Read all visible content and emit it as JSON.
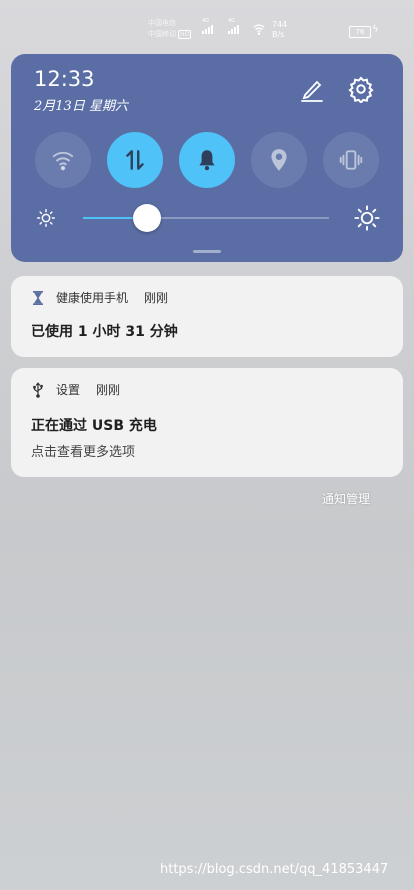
{
  "status_bar": {
    "carrier_1": "中国电信",
    "carrier_2": "中国移动",
    "hd_badge": "HD",
    "net_1": "4G",
    "net_2": "4G",
    "speed_value": "744",
    "speed_unit": "B/s",
    "battery": "76"
  },
  "quick_settings": {
    "time": "12:33",
    "date": "2月13日 星期六",
    "brightness_level": 0.26,
    "accent_color": "#4fc3f7",
    "panel_color": "#5a6ea5",
    "tiles": [
      {
        "icon": "wifi-icon",
        "active": false
      },
      {
        "icon": "mobile-data-icon",
        "active": true
      },
      {
        "icon": "bell-icon",
        "active": true
      },
      {
        "icon": "location-icon",
        "active": false
      },
      {
        "icon": "vibrate-icon",
        "active": false
      }
    ]
  },
  "notifications": [
    {
      "app": "健康使用手机",
      "time": "刚刚",
      "icon": "hourglass-icon",
      "title": "已使用 1 小时 31 分钟"
    },
    {
      "app": "设置",
      "time": "刚刚",
      "icon": "usb-icon",
      "title": "正在通过 USB 充电",
      "subtitle": "点击查看更多选项"
    }
  ],
  "notification_management": "通知管理",
  "watermark": "https://blog.csdn.net/qq_41853447"
}
